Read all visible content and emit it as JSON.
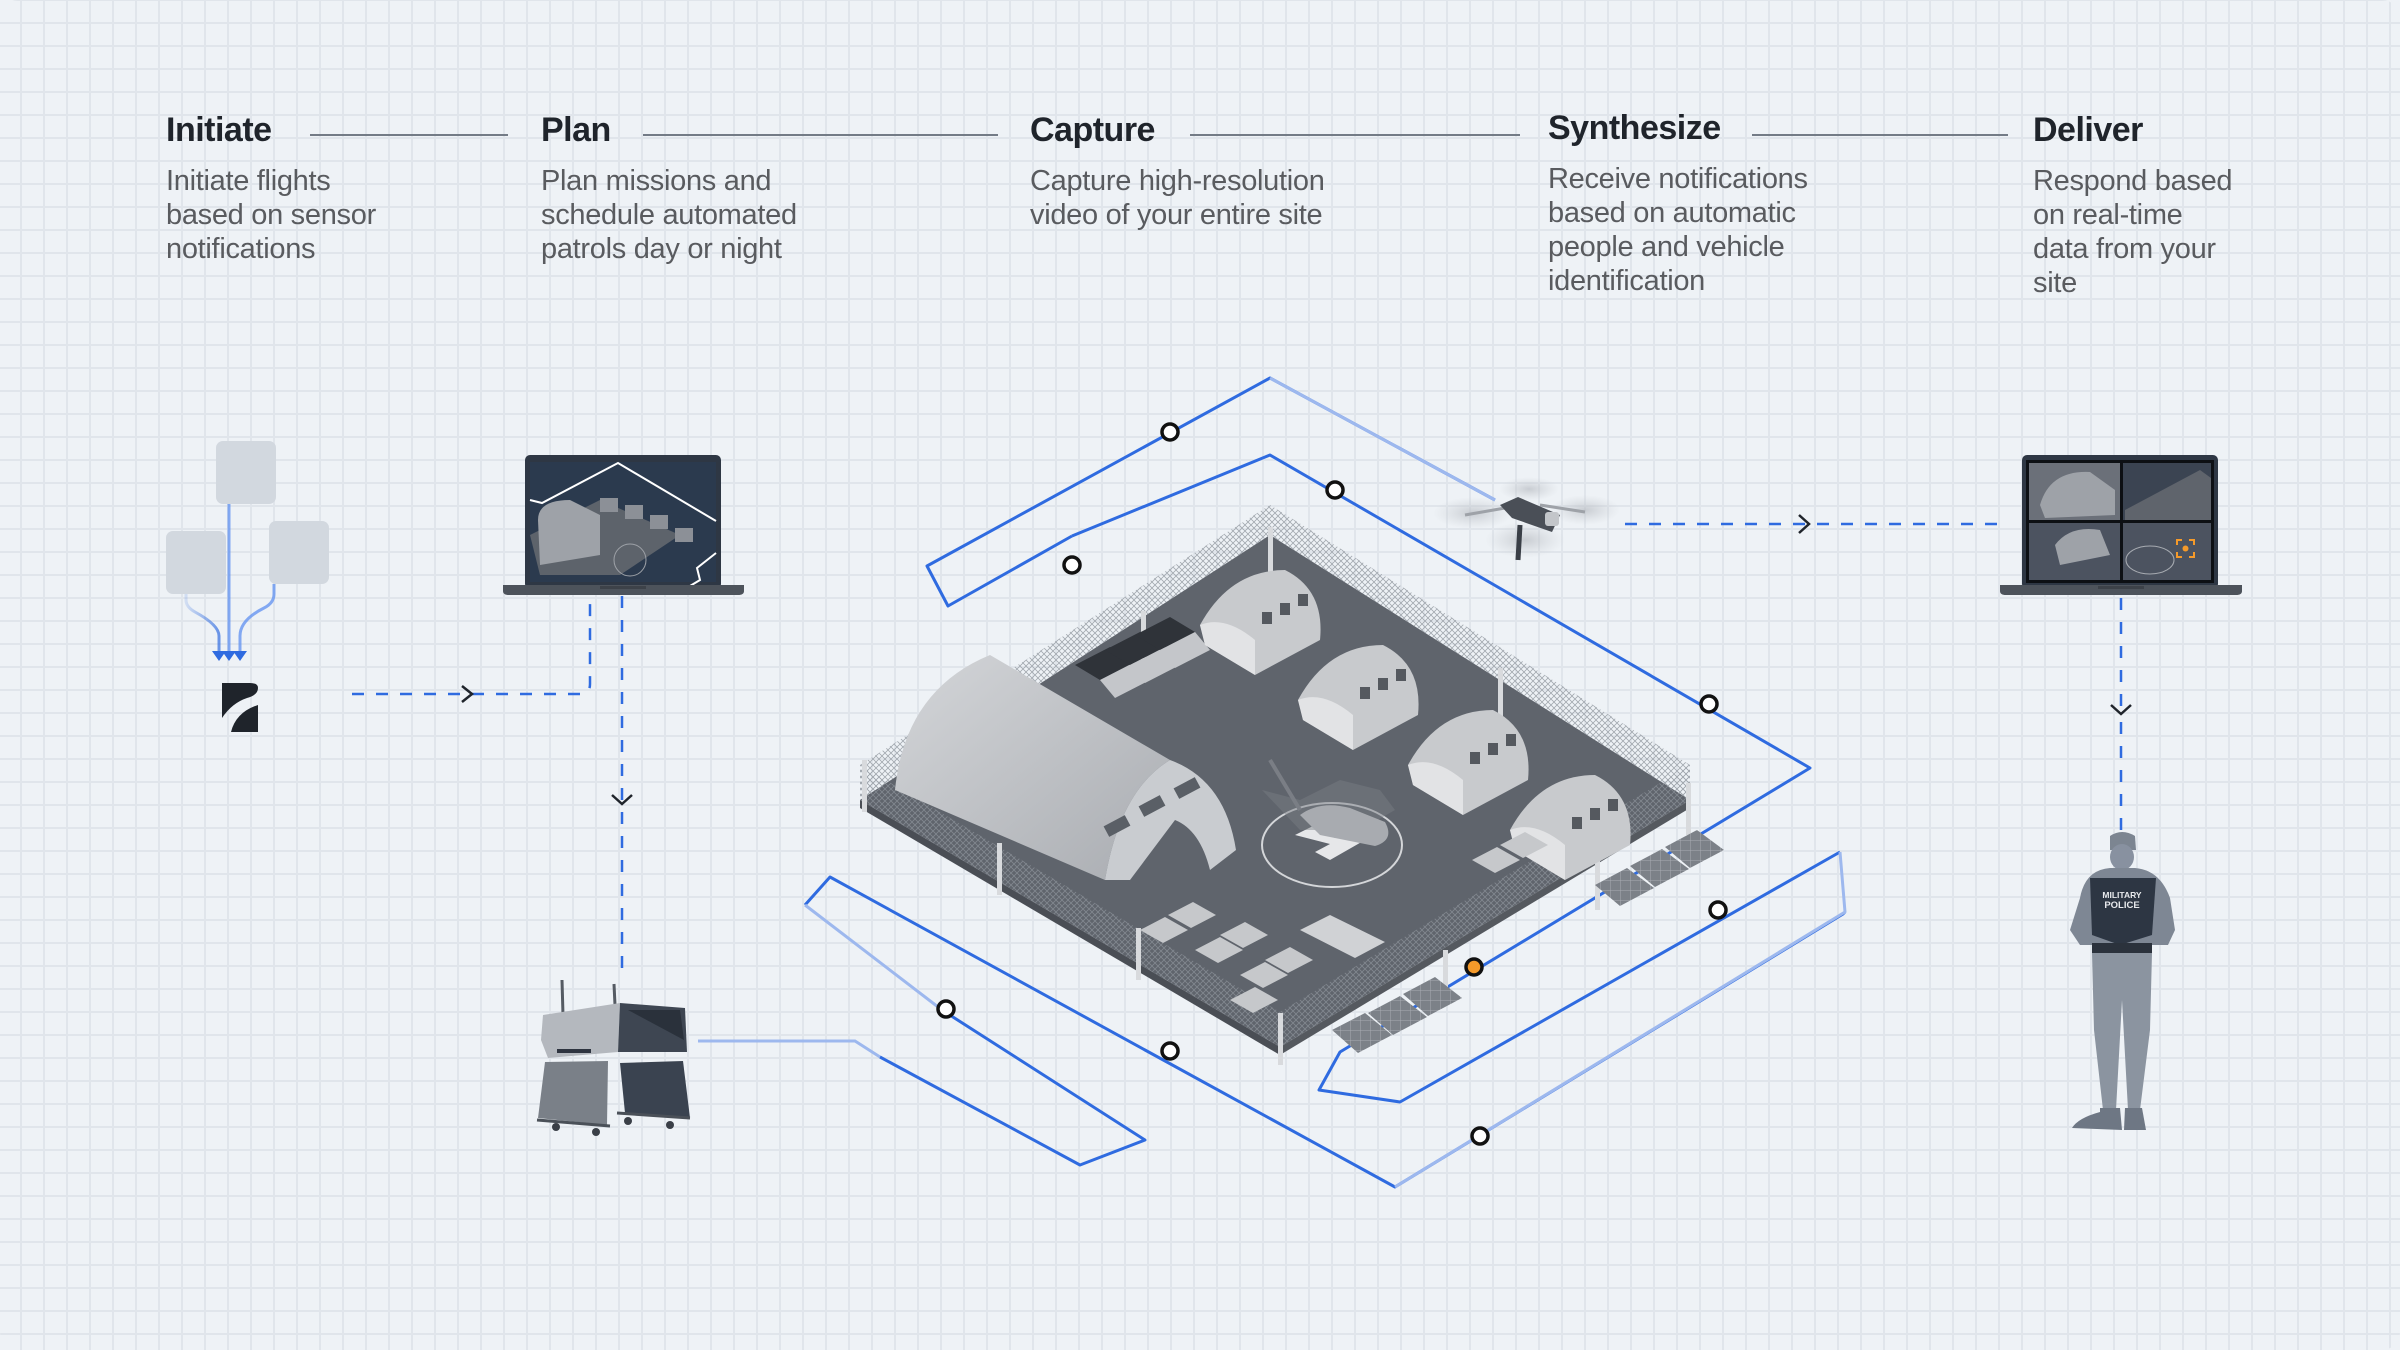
{
  "steps": [
    {
      "title": "Initiate",
      "description": "Initiate flights based on sensor notifications",
      "lines": [
        "Initiate flights",
        "based on sensor",
        "notifications"
      ]
    },
    {
      "title": "Plan",
      "description": "Plan missions and schedule automated patrols day or night",
      "lines": [
        "Plan missions and",
        "schedule automated",
        "patrols day or night"
      ]
    },
    {
      "title": "Capture",
      "description": "Capture high-resolution video of your entire site",
      "lines": [
        "Capture high-resolution",
        "video of your entire site"
      ]
    },
    {
      "title": "Synthesize",
      "description": "Receive notifications based on automatic people and vehicle identification",
      "lines": [
        "Receive notifications",
        "based on automatic",
        "people and vehicle",
        "identification"
      ]
    },
    {
      "title": "Deliver",
      "description": "Respond based on real-time data from your site",
      "lines": [
        "Respond based",
        "on real-time",
        "data from your",
        "site"
      ]
    }
  ],
  "illustrations": {
    "sensors": {
      "icon": "sensor-tiles",
      "count": 3
    },
    "logo": {
      "icon": "brand-logo-icon"
    },
    "planning_laptop": {
      "icon": "laptop-with-base-map"
    },
    "dock": {
      "icon": "drone-dock-station"
    },
    "base": {
      "icon": "isometric-military-base"
    },
    "drone": {
      "icon": "quadcopter-drone"
    },
    "monitor_laptop": {
      "icon": "laptop-with-camera-grid",
      "camera_feeds": 4
    },
    "responder": {
      "icon": "soldier",
      "vest_text_line1": "MILITARY",
      "vest_text_line2": "POLICE"
    }
  },
  "colors": {
    "accent": "#2f6be0",
    "accent_light": "#9db8ee",
    "alert": "#f59a2a",
    "heading": "#1f242b",
    "body": "#595b5f",
    "divider": "#737b86",
    "background": "#eef2f6",
    "grid": "#e0e5eb"
  }
}
